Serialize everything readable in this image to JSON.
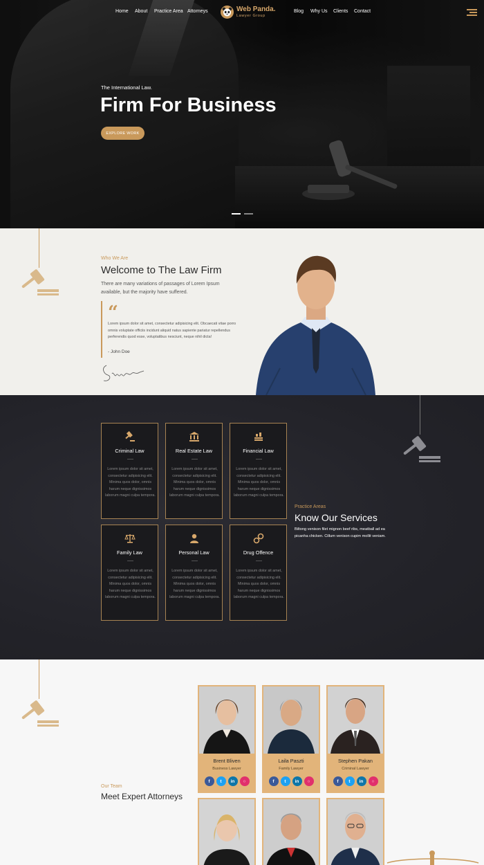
{
  "nav": {
    "left": [
      "Home",
      "About",
      "Practice Area",
      "Attorneys"
    ],
    "right": [
      "Blog",
      "Why Us",
      "Clients",
      "Contact"
    ],
    "logo_title": "Web Panda.",
    "logo_subtitle": "Lawyer Group"
  },
  "hero": {
    "tagline": "The International Law.",
    "title": "Firm For Business",
    "button": "EXPLORE WORK"
  },
  "about": {
    "eyebrow": "Who We Are",
    "title": "Welcome to The Law Firm",
    "lead": "There are many variations of passages of Lorem Ipsum available, but the majority have suffered.",
    "quote": "Lorem ipsum dolor sit amet, consectetur adipisicing elit. Obcaecati vitae porro omnis voluptate officiis incidunt aliquid natus sapiente pariatur repellendus perferendis quod esse, voluptatibus nesciunt, neque nihil dicta!",
    "quote_author": "- John Doe"
  },
  "services": {
    "eyebrow": "Practice Areas",
    "title": "Know Our Services",
    "description": "Biltong venison filet mignon beef ribs, meatball ad ea picanha chicken. Cillum venison cupim mollit veniam.",
    "card_text": "Lorem ipsum dolor sit amet, consectetur adipisicing elit. Minima quos dolor, omnis harum neque dignissimos laborum magni culpa tempora.",
    "items": [
      {
        "title": "Criminal Law",
        "icon": "gavel-icon"
      },
      {
        "title": "Real Estate Law",
        "icon": "courthouse-icon"
      },
      {
        "title": "Financial Law",
        "icon": "money-stack-icon"
      },
      {
        "title": "Family Law",
        "icon": "scales-icon"
      },
      {
        "title": "Personal Law",
        "icon": "person-icon"
      },
      {
        "title": "Drug Offence",
        "icon": "handcuffs-icon"
      }
    ]
  },
  "team": {
    "eyebrow": "Our Team",
    "title": "Meet Expert Attorneys",
    "members": [
      {
        "name": "Brent Bliven",
        "role": "Business Lawyer"
      },
      {
        "name": "Laila Paszti",
        "role": "Family Lawyer"
      },
      {
        "name": "Stephen Pakan",
        "role": "Criminal Lawyer"
      }
    ],
    "social_icons": [
      "facebook-icon",
      "twitter-icon",
      "linkedin-icon",
      "instagram-icon"
    ]
  },
  "colors": {
    "accent": "#c9995b",
    "dark": "#232329",
    "facebook": "#3b5998",
    "twitter": "#1da1f2",
    "linkedin": "#0e76a8",
    "instagram": "#e1306c"
  }
}
